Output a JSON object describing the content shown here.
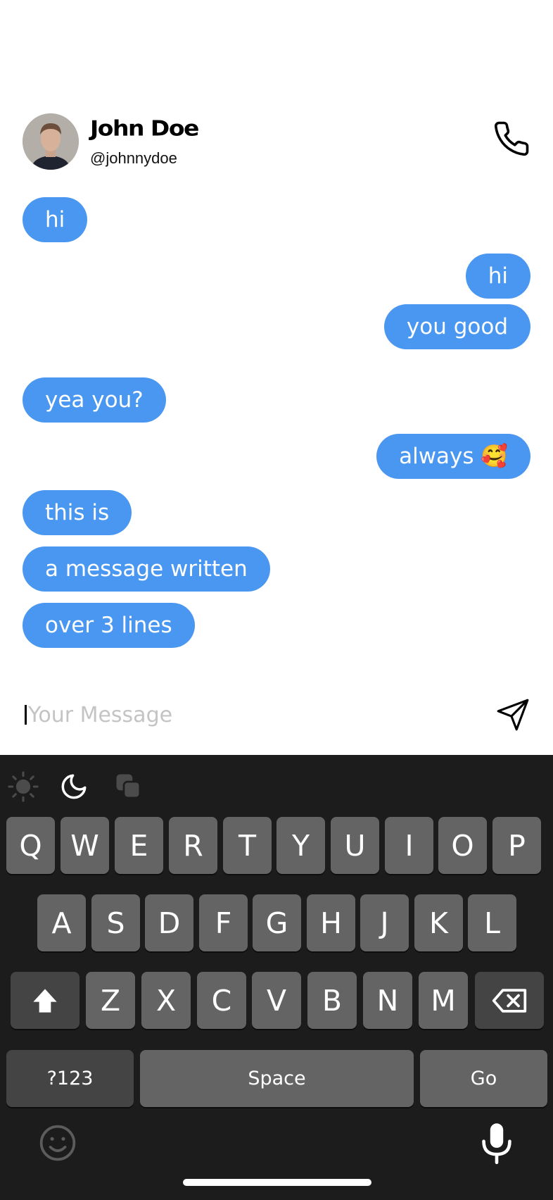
{
  "contact": {
    "name": "John Doe",
    "handle": "@johnnydoe"
  },
  "messages": [
    {
      "side": "left",
      "text": "hi"
    },
    {
      "side": "right",
      "text": "hi"
    },
    {
      "side": "right",
      "text": "you good"
    },
    {
      "side": "left",
      "text": "yea you?"
    },
    {
      "side": "right",
      "text": "always 🥰"
    },
    {
      "side": "left",
      "text": "this is"
    },
    {
      "side": "left",
      "text": "a message written"
    },
    {
      "side": "left",
      "text": "over 3 lines"
    }
  ],
  "composer": {
    "placeholder": "Your Message",
    "value": ""
  },
  "keyboard": {
    "row1": [
      "Q",
      "W",
      "E",
      "R",
      "T",
      "Y",
      "U",
      "I",
      "O",
      "P"
    ],
    "row2": [
      "A",
      "S",
      "D",
      "F",
      "G",
      "H",
      "J",
      "K",
      "L"
    ],
    "row3": [
      "Z",
      "X",
      "C",
      "V",
      "B",
      "N",
      "M"
    ],
    "symbols_label": "?123",
    "space_label": "Space",
    "go_label": "Go"
  },
  "colors": {
    "bubble": "#4a97f1",
    "keyboard_bg": "#1c1c1c",
    "key": "#646464"
  }
}
